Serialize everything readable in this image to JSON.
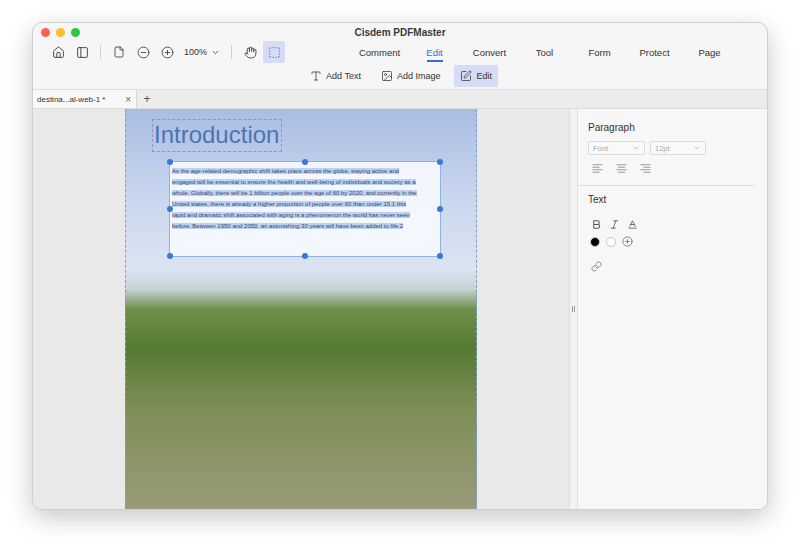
{
  "window": {
    "title": "Cisdem PDFMaster"
  },
  "toolbar": {
    "zoom": "100%",
    "pointer_tools": [
      {
        "selected": false
      },
      {
        "selected": true
      }
    ]
  },
  "menu": [
    {
      "label": "Comment",
      "selected": false
    },
    {
      "label": "Edit",
      "selected": true
    },
    {
      "label": "Convert",
      "selected": false
    },
    {
      "label": "Tool",
      "selected": false
    },
    {
      "label": "Form",
      "selected": false
    },
    {
      "label": "Protect",
      "selected": false
    },
    {
      "label": "Page",
      "selected": false
    }
  ],
  "edit_tools": [
    {
      "label": "Add Text",
      "selected": false
    },
    {
      "label": "Add Image",
      "selected": false
    },
    {
      "label": "Edit",
      "selected": true
    }
  ],
  "document_tabs": {
    "tabs": [
      {
        "label": "destina...al-web-1 *",
        "selected": true,
        "close": "×"
      }
    ],
    "add": "+"
  },
  "page": {
    "heading": "Introduction",
    "text_box": {
      "selected": true,
      "lines": [
        "As the age-related demographic shift takes place across the globe, staying active and",
        "engaged will be essential to ensure the health and well-being of individuals and society as a",
        "whole. Globally, there will be 1 billion people over the age of 60 by 2020, and currently in the",
        "United states, there is already a higher proportion of people over 60 than under 15.1 this",
        "rapid and dramatic shift associated with aging is a phenomenon the world has never seen",
        "before. Between 1950 and 2050, an astonishing 30 years will have been added to life.2"
      ]
    }
  },
  "properties": {
    "paragraph": {
      "title": "Paragraph",
      "font": "Font",
      "size": "12pt",
      "disabled": true
    },
    "text": {
      "title": "Text",
      "colors": [
        {
          "color": "#000000"
        },
        {
          "color": "#ffffff"
        }
      ]
    }
  }
}
